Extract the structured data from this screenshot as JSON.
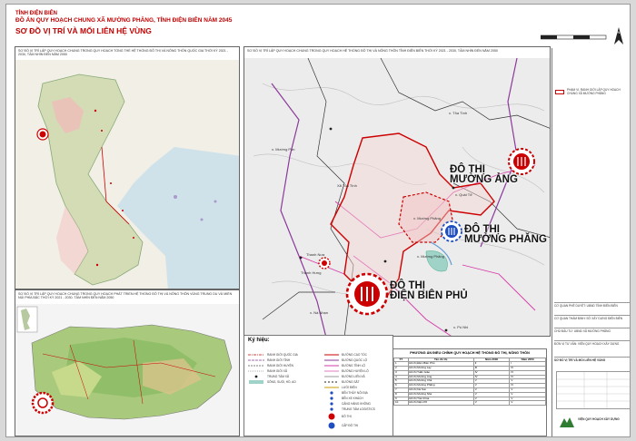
{
  "header": {
    "province": "TỈNH ĐIỆN BIÊN",
    "project": "ĐỒ ÁN QUY HOẠCH CHUNG XÃ MƯỜNG PHĂNG, TỈNH ĐIỆN BIÊN NĂM 2045",
    "title": "SƠ ĐỒ VỊ TRÍ VÀ MỐI LIÊN HỆ VÙNG"
  },
  "panels": {
    "national_caption": "SƠ ĐỒ VỊ TRÍ LẬP QUY HOẠCH CHUNG TRONG QUY HOẠCH TỔNG THỂ HỆ THỐNG ĐÔ THỊ VÀ NÔNG THÔN QUỐC GIA THỜI KỲ 2021 - 2030, TẦM NHÌN ĐẾN NĂM 2050",
    "regional_caption": "SƠ ĐỒ VỊ TRÍ LẬP QUY HOẠCH CHUNG TRONG QUY HOẠCH PHÁT TRIỂN HỆ THỐNG ĐÔ THỊ VÀ NÔNG THÔN VÙNG TRUNG DU VÀ MIỀN NÚI PHÍA BẮC THỜI KỲ 2021 - 2030, TẦM NHÌN ĐẾN NĂM 2050",
    "main_caption": "SƠ ĐỒ VỊ TRÍ LẬP QUY HOẠCH CHUNG TRONG QUY HOẠCH HỆ THỐNG ĐÔ THỊ VÀ NÔNG THÔN TỈNH ĐIỆN BIÊN THỜI KỲ 2021 - 2030, TẦM NHÌN ĐẾN NĂM 2050"
  },
  "map": {
    "labels": {
      "muong_ang": "ĐÔ THỊ\nMƯỜNG ẢNG",
      "muong_phang": "ĐÔ THỊ\nMƯỜNG PHĂNG",
      "dien_bien_phu": "ĐÔ THỊ\nĐIỆN BIÊN PHỦ"
    },
    "places": [
      "x. Tỏa Tình",
      "Xã Tỏa Tình",
      "x. Quài Tở",
      "x. Mường Phăng",
      "Thanh Nưa",
      "x. Mường Phăng",
      "x. Pú Nhi",
      "x. Mường Pồn",
      "Thanh Hưng",
      "x. Nà Nhạn"
    ]
  },
  "legend": {
    "title": "Ký hiệu:",
    "col1": [
      "RANH GIỚI QUỐC GIA",
      "RANH GIỚI TỈNH",
      "RANH GIỚI HUYỆN",
      "RANH GIỚI XÃ",
      "TRUNG TÂM XÃ",
      "SÔNG, SUỐI, HỒ, AO"
    ],
    "col2": [
      "ĐƯỜNG CAO TỐC",
      "ĐƯỜNG QUỐC LỘ",
      "ĐƯỜNG TỈNH LỘ",
      "ĐƯỜNG HUYỆN LỘ",
      "ĐƯỜNG LIÊN XÃ",
      "ĐƯỜNG SẮT",
      "LƯỚI ĐIỆN",
      "BẾN THỦY NỘI ĐỊA",
      "BẾN XE KHÁCH",
      "CẢNG HÀNG KHÔNG",
      "TRUNG TÂM LOGISTICS",
      "ĐÔ THỊ",
      "CẤP ĐÔ THỊ"
    ]
  },
  "table": {
    "caption": "PHƯƠNG ÁN ĐIỀU CHỈNH QUY HOẠCH HỆ THỐNG ĐÔ THỊ, NÔNG THÔN",
    "headers": [
      "TT",
      "Tên đô thị",
      "Năm 2030",
      "Năm 2050"
    ],
    "rows": [
      [
        "1",
        "Đô thị Điện Biên Phủ",
        "II",
        "I"
      ],
      [
        "2",
        "Đô thị Mường Lay",
        "III",
        "III"
      ],
      [
        "3",
        "Đô thị Tuần Giáo",
        "IV",
        "IV"
      ],
      [
        "4",
        "Đô thị Mường Ảng",
        "IV",
        "IV"
      ],
      [
        "5",
        "Đô thị Mường Chà",
        "V",
        "V"
      ],
      [
        "6",
        "Đô thị Mường Phăng",
        "V",
        "IV"
      ],
      [
        "7",
        "Đô thị Na Son",
        "V",
        "V"
      ],
      [
        "8",
        "Đô thị Mường Nhé",
        "V",
        "V"
      ],
      [
        "9",
        "Đô thị Tủa Chùa",
        "V",
        "V"
      ],
      [
        "10",
        "Đô thị Nậm Pồ",
        "V",
        "V"
      ]
    ]
  },
  "sidebar": {
    "legend_note": "PHẠM VI, RANH GIỚI LẬP QUY HOẠCH CHUNG XÃ MƯỜNG PHĂNG",
    "approval": "CƠ QUAN PHÊ DUYỆT: UBND TỈNH ĐIỆN BIÊN",
    "appraisal": "CƠ QUAN THẨM ĐỊNH: SỞ XÂY DỰNG ĐIỆN BIÊN",
    "investor": "CHỦ ĐẦU TƯ: UBND XÃ MƯỜNG PHĂNG",
    "consultant": "ĐƠN VỊ TƯ VẤN: VIỆN QUY HOẠCH XÂY DỰNG",
    "drawing": "SƠ ĐỒ VỊ TRÍ VÀ MỐI LIÊN HỆ VÙNG",
    "logo_text": "VIỆN QUY HOẠCH XÂY DỰNG"
  },
  "colors": {
    "red": "#c00000",
    "purple": "#8b3a9a",
    "magenta": "#d63aa8",
    "blue": "#1f4fbf",
    "green": "#2e7d32"
  }
}
